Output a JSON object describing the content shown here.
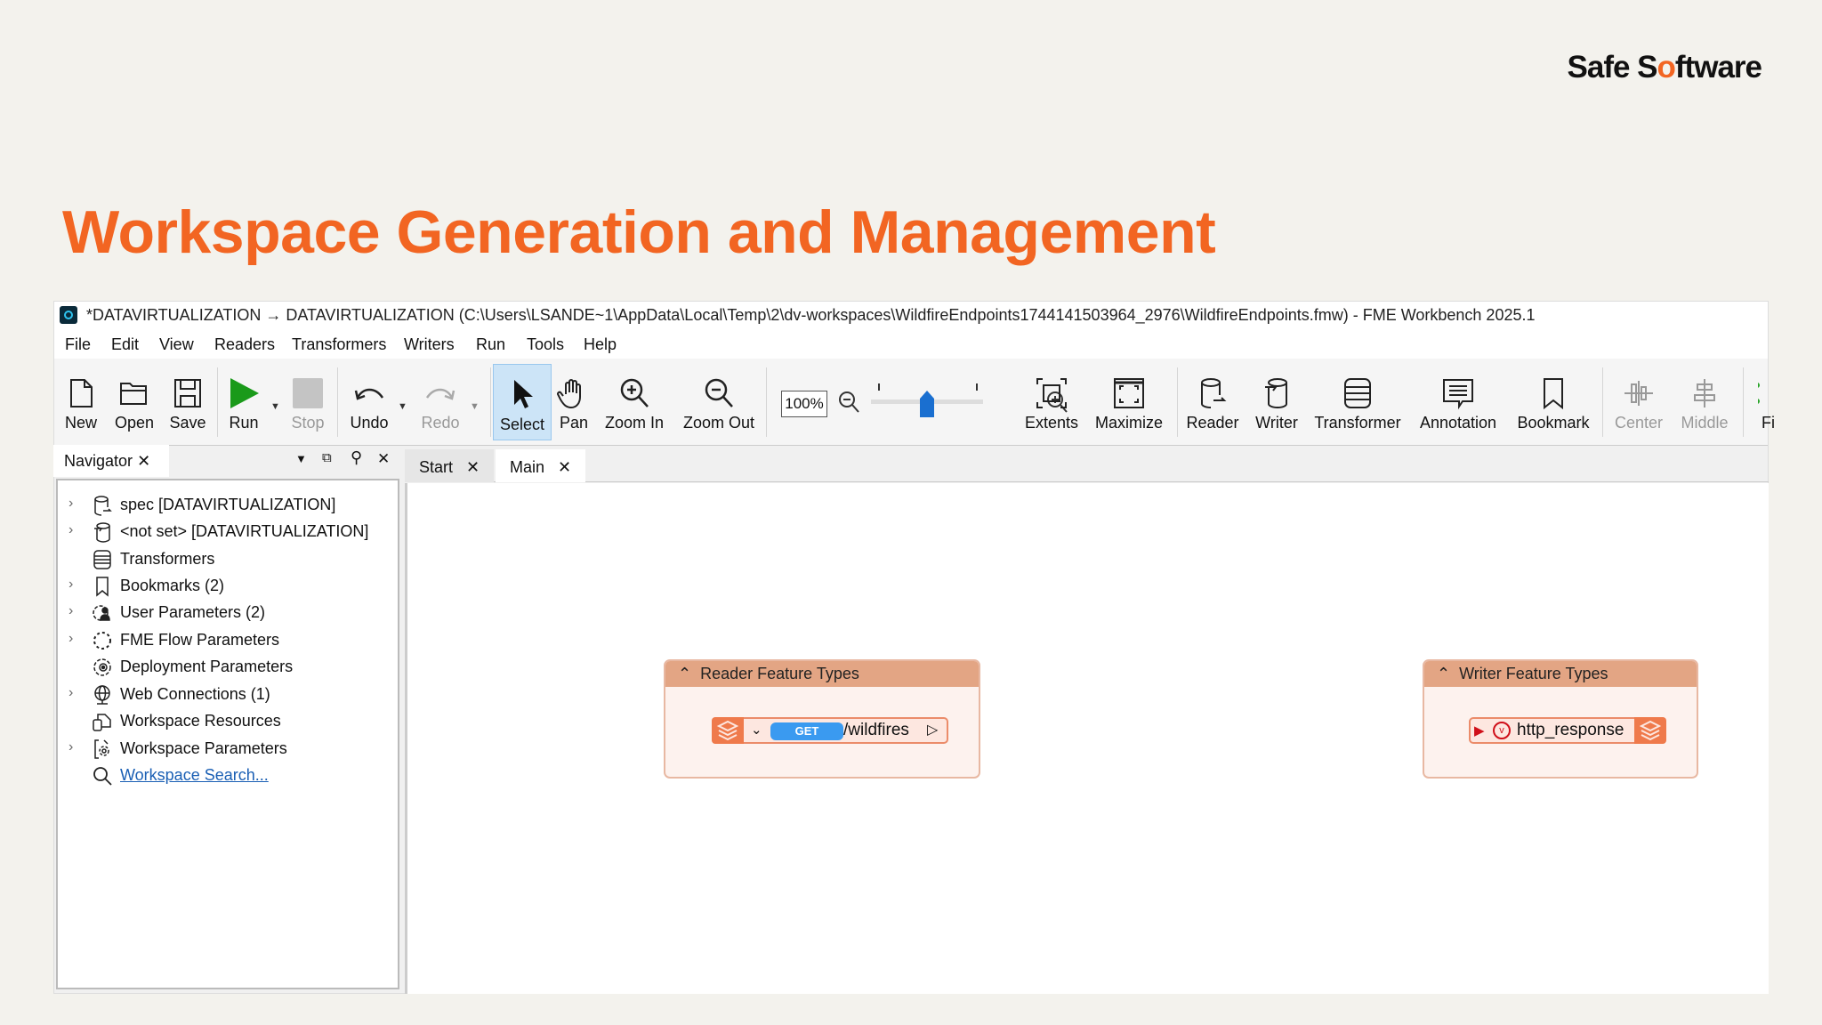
{
  "slide": {
    "logo": {
      "pre": "Safe S",
      "dot": "o",
      "post": "ftware"
    },
    "title": "Workspace Generation and Management"
  },
  "window": {
    "title": "*DATAVIRTUALIZATION → DATAVIRTUALIZATION (C:\\Users\\LSANDE~1\\AppData\\Local\\Temp\\2\\dv-workspaces\\WildfireEndpoints1744141503964_2976\\WildfireEndpoints.fmw) - FME Workbench 2025.1"
  },
  "menu": [
    "File",
    "Edit",
    "View",
    "Readers",
    "Transformers",
    "Writers",
    "Run",
    "Tools",
    "Help"
  ],
  "toolbar": {
    "new": "New",
    "open": "Open",
    "save": "Save",
    "run": "Run",
    "stop": "Stop",
    "undo": "Undo",
    "redo": "Redo",
    "select": "Select",
    "pan": "Pan",
    "zoom_in": "Zoom In",
    "zoom_out": "Zoom Out",
    "zoom_level": "100%",
    "zoom_slider_fraction": 0.5,
    "extents": "Extents",
    "maximize": "Maximize",
    "reader": "Reader",
    "writer": "Writer",
    "transformer": "Transformer",
    "annotation": "Annotation",
    "bookmark": "Bookmark",
    "center": "Center",
    "middle": "Middle",
    "more": "Fi"
  },
  "navigator": {
    "title": "Navigator",
    "items": [
      {
        "label": "spec [DATAVIRTUALIZATION]",
        "expandable": true
      },
      {
        "label": "<not set> [DATAVIRTUALIZATION]",
        "expandable": true
      },
      {
        "label": "Transformers",
        "expandable": false
      },
      {
        "label": "Bookmarks (2)",
        "expandable": true
      },
      {
        "label": "User Parameters (2)",
        "expandable": true
      },
      {
        "label": "FME Flow Parameters",
        "expandable": true
      },
      {
        "label": "Deployment Parameters",
        "expandable": false
      },
      {
        "label": "Web Connections (1)",
        "expandable": true
      },
      {
        "label": "Workspace Resources",
        "expandable": false
      },
      {
        "label": "Workspace Parameters",
        "expandable": true
      },
      {
        "label": "Workspace Search...",
        "expandable": false
      }
    ]
  },
  "tabs": [
    {
      "label": "Start"
    },
    {
      "label": "Main"
    }
  ],
  "canvas": {
    "reader": {
      "header": "Reader Feature Types",
      "method": "GET",
      "path": "/wildfires"
    },
    "writer": {
      "header": "Writer Feature Types",
      "name": "http_response"
    }
  },
  "colors": {
    "accent": "#f26522",
    "run": "#1a9a1a",
    "slider": "#1a6fd0"
  }
}
